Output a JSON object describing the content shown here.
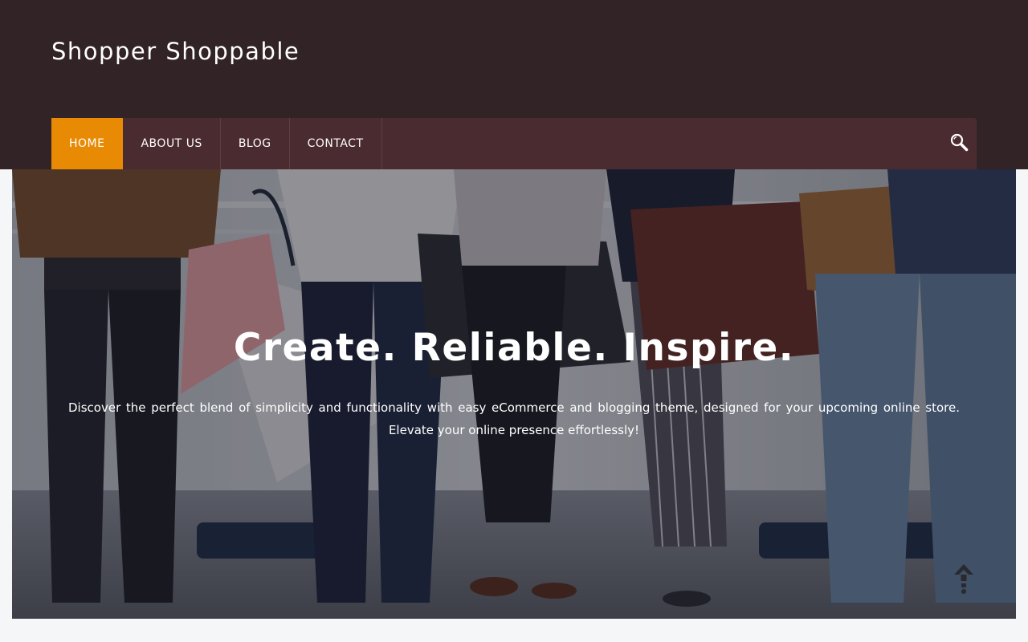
{
  "site": {
    "title": "Shopper Shoppable"
  },
  "nav": {
    "items": [
      {
        "label": "HOME",
        "active": true
      },
      {
        "label": "ABOUT US",
        "active": false
      },
      {
        "label": "BLOG",
        "active": false
      },
      {
        "label": "CONTACT",
        "active": false
      }
    ],
    "search_icon": "search-icon"
  },
  "hero": {
    "title": "Create. Reliable. Inspire.",
    "text": "Discover the perfect blend of simplicity and functionality with easy eCommerce and blogging theme, designed for your upcoming online store. Elevate your online presence effortlessly!",
    "image_description": "people holding shopping bags",
    "scroll_top_icon": "arrow-up-icon"
  },
  "colors": {
    "header_bg": "#322326",
    "nav_bg": "#4a2b30",
    "accent": "#e98a05",
    "page_bg": "#f5f6f8"
  }
}
